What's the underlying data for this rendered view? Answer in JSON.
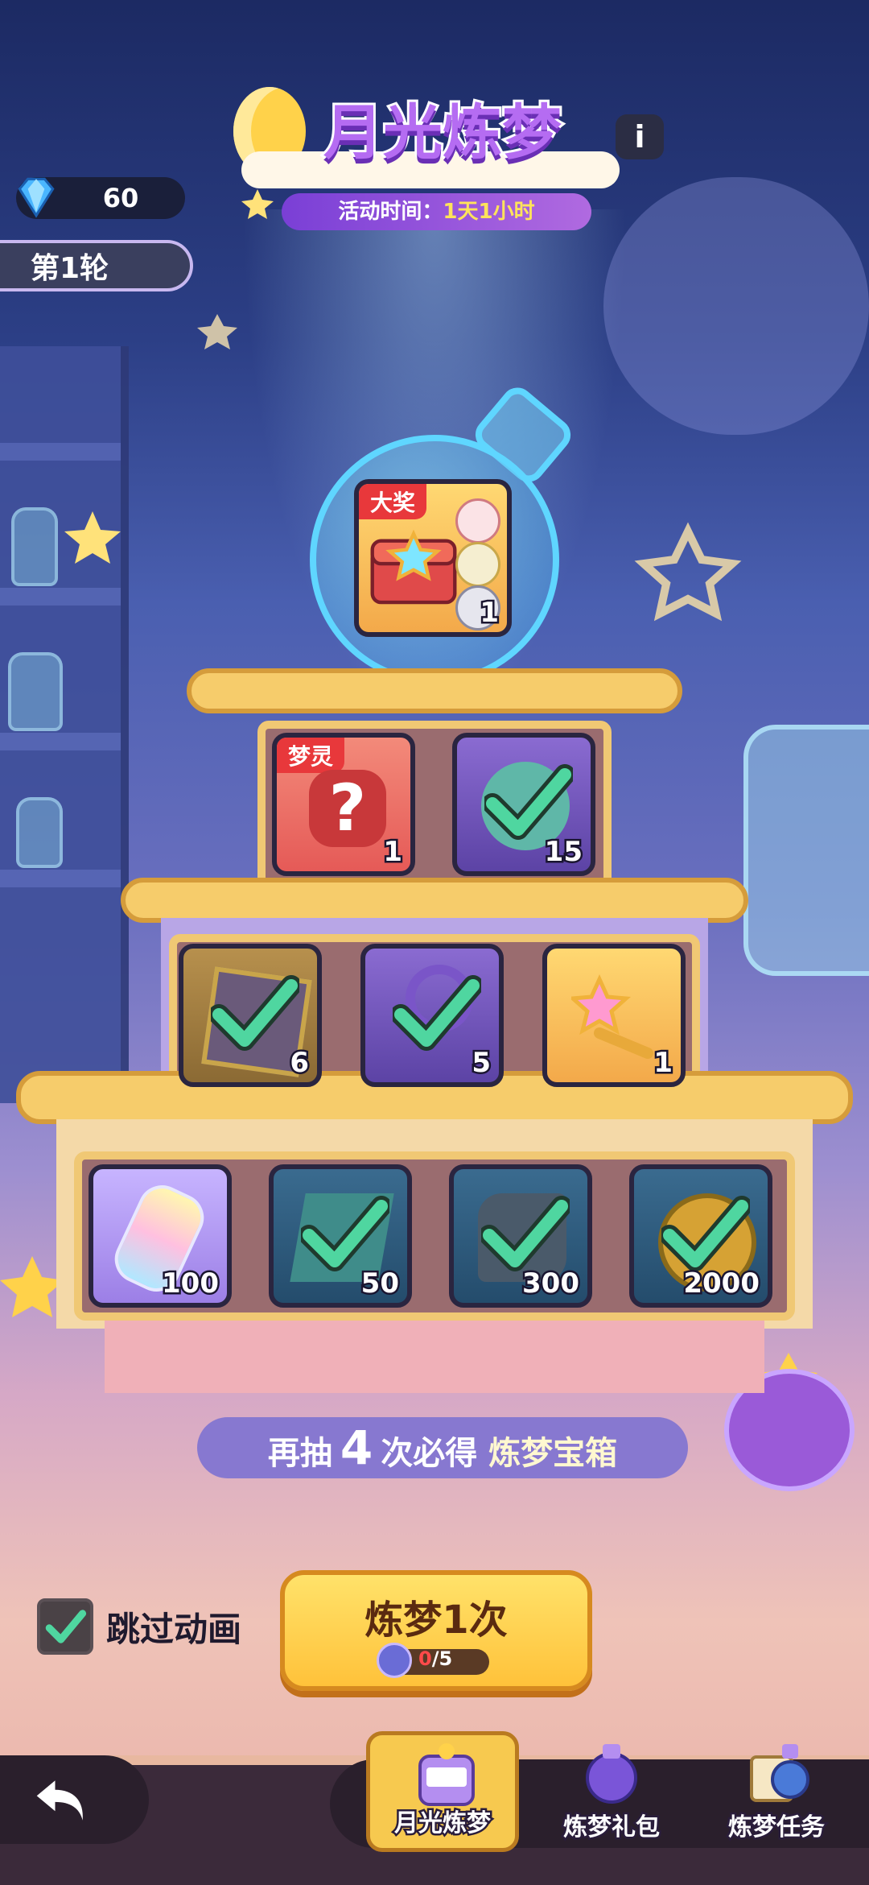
{
  "header": {
    "title": "月光炼梦",
    "event_time_label": "活动时间：",
    "event_time_value": "1天1小时",
    "gems": "60",
    "round": "第1轮"
  },
  "grand_prize": {
    "tag": "大奖",
    "qty": "1"
  },
  "rewards": {
    "row1": [
      {
        "tag": "梦灵",
        "qty": "1",
        "claimed": false,
        "icon": "mystery-icon"
      },
      {
        "qty": "15",
        "claimed": true,
        "icon": "pet-egg-icon"
      }
    ],
    "row2": [
      {
        "qty": "6",
        "claimed": true,
        "icon": "crate-icon"
      },
      {
        "qty": "5",
        "claimed": true,
        "icon": "purple-key-icon"
      },
      {
        "qty": "1",
        "claimed": false,
        "icon": "star-key-icon"
      }
    ],
    "row3": [
      {
        "qty": "100",
        "claimed": false,
        "icon": "rainbow-bottle-icon"
      },
      {
        "qty": "50",
        "claimed": true,
        "icon": "map-icon"
      },
      {
        "qty": "300",
        "claimed": true,
        "icon": "ore-icon"
      },
      {
        "qty": "2000",
        "claimed": true,
        "icon": "coin-icon"
      }
    ]
  },
  "banner": {
    "prefix": "再抽",
    "count": "4",
    "middle": "次必得",
    "reward": "炼梦宝箱"
  },
  "controls": {
    "skip_label": "跳过动画",
    "draw_label": "炼梦1次",
    "cost_have": "0",
    "cost_total": "/5"
  },
  "nav": {
    "tabs": [
      {
        "label": "月光炼梦",
        "active": true
      },
      {
        "label": "炼梦礼包",
        "active": false
      },
      {
        "label": "炼梦任务",
        "active": false
      }
    ]
  },
  "colors": {
    "accent_gold": "#f7c94f",
    "check_green": "#4fd6a0",
    "title_purple": "#b56cf2"
  }
}
